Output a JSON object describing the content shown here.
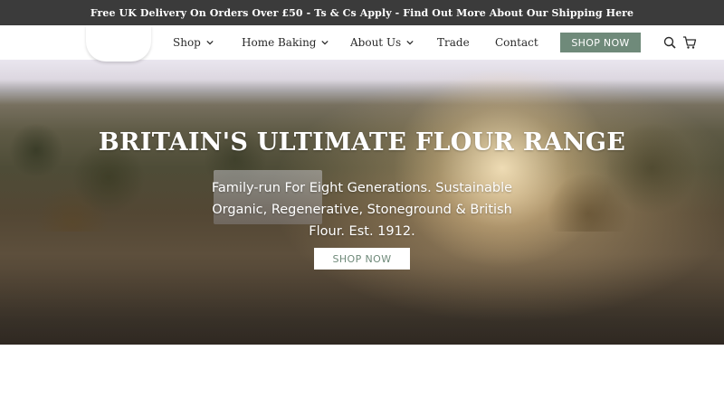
{
  "announcement": {
    "text": "Free UK Delivery On Orders Over £50 - Ts & Cs Apply - Find Out More About Our Shipping Here"
  },
  "nav": {
    "items": [
      {
        "label": "Shop",
        "has_dropdown": true
      },
      {
        "label": "Home Baking",
        "has_dropdown": true
      },
      {
        "label": "About Us",
        "has_dropdown": true
      },
      {
        "label": "Trade",
        "has_dropdown": false
      },
      {
        "label": "Contact",
        "has_dropdown": false
      }
    ],
    "shop_button": "SHOP NOW",
    "icons": [
      "search-icon",
      "cart-icon"
    ]
  },
  "hero": {
    "title": "BRITAIN'S ULTIMATE FLOUR RANGE",
    "subtitle": "Family-run For Eight Generations. Sustainable Organic, Regenerative, Stoneground & British Flour. Est. 1912.",
    "button": "SHOP NOW"
  },
  "colors": {
    "announcement_bg": "#3b3b3b",
    "accent": "#6f8a7a",
    "nav_bg": "#ffffff"
  }
}
